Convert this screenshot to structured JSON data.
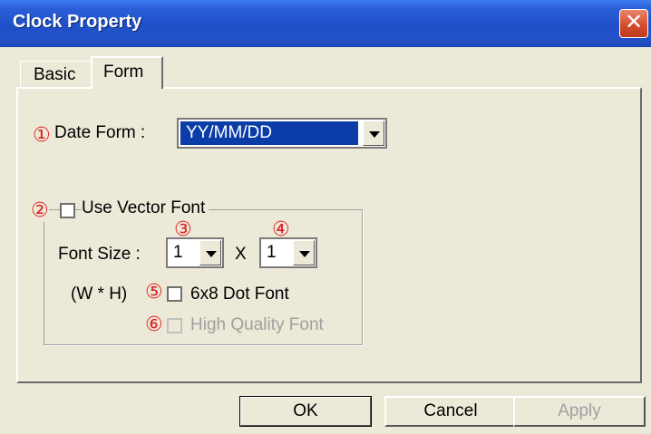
{
  "window": {
    "title": "Clock Property",
    "close_icon": "close-icon"
  },
  "tabs": [
    {
      "label": "Basic",
      "active": false
    },
    {
      "label": "Form",
      "active": true
    }
  ],
  "date_form": {
    "marker": "①",
    "label": "Date Form :",
    "value": "YY/MM/DD"
  },
  "vector_font": {
    "marker": "②",
    "label": "Use Vector Font",
    "checked": false
  },
  "font_size": {
    "label": "Font Size :",
    "sub_label": "(W * H)",
    "width_marker": "③",
    "width_value": "1",
    "separator": "X",
    "height_marker": "④",
    "height_value": "1"
  },
  "dot_font": {
    "marker": "⑤",
    "label": "6x8 Dot Font",
    "checked": false
  },
  "high_quality": {
    "marker": "⑥",
    "label": "High Quality Font",
    "checked": false,
    "enabled": false
  },
  "buttons": {
    "ok": "OK",
    "cancel": "Cancel",
    "apply": "Apply"
  },
  "colors": {
    "titlebar": "#1f4fc8",
    "selection": "#0a3da8",
    "marker": "#e02020"
  }
}
